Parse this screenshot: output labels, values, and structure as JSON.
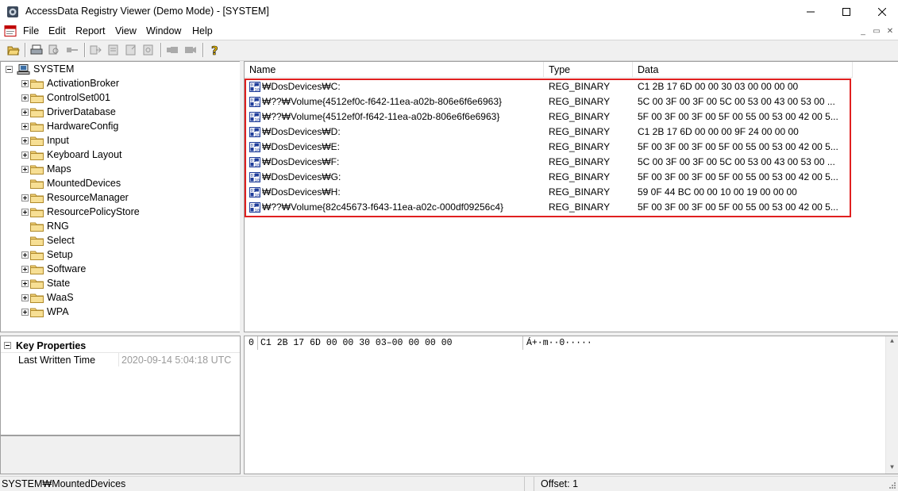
{
  "window": {
    "title": "AccessData Registry Viewer (Demo Mode) - [SYSTEM]",
    "minimize_glyph": "—",
    "maximize_glyph": "☐",
    "close_glyph": "✕"
  },
  "menu": {
    "items": [
      "File",
      "Edit",
      "Report",
      "View",
      "Window",
      "Help"
    ],
    "mdi_minimize": "_",
    "mdi_restore": "▭",
    "mdi_close": "✕"
  },
  "toolbar": {
    "buttons": [
      "open-icon",
      "print-icon",
      "find-icon",
      "key-icon",
      "export-icon",
      "report-icon",
      "add-report-icon",
      "summary-icon",
      "view-icon",
      "video-icon",
      "help-icon"
    ]
  },
  "tree": {
    "root": "SYSTEM",
    "children": [
      {
        "label": "ActivationBroker",
        "expandable": true
      },
      {
        "label": "ControlSet001",
        "expandable": true
      },
      {
        "label": "DriverDatabase",
        "expandable": true
      },
      {
        "label": "HardwareConfig",
        "expandable": true
      },
      {
        "label": "Input",
        "expandable": true
      },
      {
        "label": "Keyboard Layout",
        "expandable": true
      },
      {
        "label": "Maps",
        "expandable": true
      },
      {
        "label": "MountedDevices",
        "expandable": false
      },
      {
        "label": "ResourceManager",
        "expandable": true
      },
      {
        "label": "ResourcePolicyStore",
        "expandable": true
      },
      {
        "label": "RNG",
        "expandable": false
      },
      {
        "label": "Select",
        "expandable": false
      },
      {
        "label": "Setup",
        "expandable": true
      },
      {
        "label": "Software",
        "expandable": true
      },
      {
        "label": "State",
        "expandable": true
      },
      {
        "label": "WaaS",
        "expandable": true
      },
      {
        "label": "WPA",
        "expandable": true
      }
    ]
  },
  "list": {
    "columns": [
      "Name",
      "Type",
      "Data"
    ],
    "rows": [
      {
        "name": "₩DosDevices₩C:",
        "type": "REG_BINARY",
        "data": "C1 2B 17 6D 00 00 30 03 00 00 00 00"
      },
      {
        "name": "₩??₩Volume{4512ef0c-f642-11ea-a02b-806e6f6e6963}",
        "type": "REG_BINARY",
        "data": "5C 00 3F 00 3F 00 5C 00 53 00 43 00 53 00 ..."
      },
      {
        "name": "₩??₩Volume{4512ef0f-f642-11ea-a02b-806e6f6e6963}",
        "type": "REG_BINARY",
        "data": "5F 00 3F 00 3F 00 5F 00 55 00 53 00 42 00 5..."
      },
      {
        "name": "₩DosDevices₩D:",
        "type": "REG_BINARY",
        "data": "C1 2B 17 6D 00 00 00 9F 24 00 00 00"
      },
      {
        "name": "₩DosDevices₩E:",
        "type": "REG_BINARY",
        "data": "5F 00 3F 00 3F 00 5F 00 55 00 53 00 42 00 5..."
      },
      {
        "name": "₩DosDevices₩F:",
        "type": "REG_BINARY",
        "data": "5C 00 3F 00 3F 00 5C 00 53 00 43 00 53 00 ..."
      },
      {
        "name": "₩DosDevices₩G:",
        "type": "REG_BINARY",
        "data": "5F 00 3F 00 3F 00 5F 00 55 00 53 00 42 00 5..."
      },
      {
        "name": "₩DosDevices₩H:",
        "type": "REG_BINARY",
        "data": "59 0F 44 BC 00 00 10 00 19 00 00 00"
      },
      {
        "name": "₩??₩Volume{82c45673-f643-11ea-a02c-000df09256c4}",
        "type": "REG_BINARY",
        "data": "5F 00 3F 00 3F 00 5F 00 55 00 53 00 42 00 5..."
      }
    ],
    "highlight_color": "#e02020"
  },
  "properties": {
    "section": "Key Properties",
    "key": "Last Written Time",
    "value": "2020-09-14 5:04:18 UTC"
  },
  "hex": {
    "offset": "0",
    "bytes": "C1 2B 17 6D 00 00 30 03–00 00 00 00",
    "ascii": "Á+·m··0·····"
  },
  "status": {
    "path": "SYSTEM₩MountedDevices",
    "offset": "Offset: 1"
  }
}
